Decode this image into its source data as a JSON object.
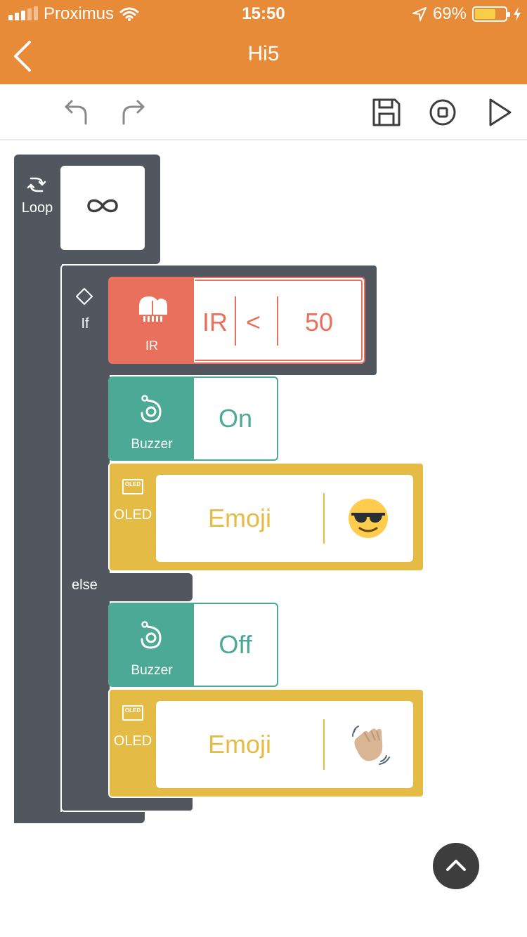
{
  "status_bar": {
    "carrier": "Proximus",
    "time": "15:50",
    "battery_percent": "69%",
    "battery_level": 0.69
  },
  "nav": {
    "title": "Hi5",
    "back_icon": "chevron-left-icon"
  },
  "toolbar": {
    "undo_icon": "undo-icon",
    "redo_icon": "redo-icon",
    "save_icon": "save-icon",
    "stop_icon": "stop-icon",
    "play_icon": "play-icon"
  },
  "program": {
    "loop": {
      "label": "Loop",
      "value_icon": "infinity-icon"
    },
    "if_block": {
      "label": "If",
      "condition": {
        "sensor_label": "IR",
        "variable": "IR",
        "operator": "<",
        "value": "50"
      },
      "then": {
        "buzzer": {
          "label": "Buzzer",
          "value": "On"
        },
        "oled": {
          "label": "OLED",
          "icon_text": "OLED",
          "mode": "Emoji",
          "emoji": "sunglasses-emoji"
        }
      },
      "else_label": "else",
      "else": {
        "buzzer": {
          "label": "Buzzer",
          "value": "Off"
        },
        "oled": {
          "label": "OLED",
          "icon_text": "OLED",
          "mode": "Emoji",
          "emoji": "waving-hand-emoji"
        }
      }
    }
  },
  "colors": {
    "header": "#e88b39",
    "block_dark": "#51565f",
    "ir": "#e9705d",
    "buzzer": "#4ba996",
    "oled": "#e4bb45"
  }
}
